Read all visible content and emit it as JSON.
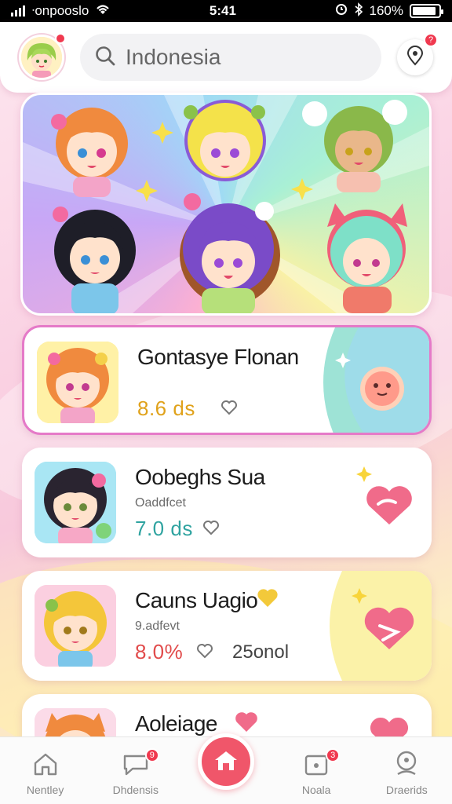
{
  "status_bar": {
    "carrier": "ᐧonpooslo",
    "time": "5:41",
    "battery": "160%",
    "battery_level": 0.9
  },
  "header": {
    "avatar_badge": "",
    "search": {
      "placeholder": "Indonesia",
      "icon": "search-icon"
    },
    "location_badge": "?"
  },
  "cards": [
    {
      "title": "Gontasye Flonan",
      "subtitle": "",
      "stat": "8.6 ds",
      "stat_color": "#e0a21b",
      "extra": "",
      "accent": "#7fd3ec"
    },
    {
      "title": "Oobeghs Sua",
      "subtitle": "Oaddfcet",
      "stat": "7.0 ds",
      "stat_color": "#2fa3a0",
      "extra": "",
      "accent": "#f06b8a"
    },
    {
      "title": "Cauns Uagio",
      "subtitle": "9.adfevt",
      "stat": "8.0%",
      "stat_color": "#e14b4b",
      "extra": "25onol",
      "accent": "#f3c93a"
    },
    {
      "title": "Aoleiage",
      "subtitle": "",
      "stat": "",
      "stat_color": "#444",
      "extra": "",
      "accent": "#f06b8a"
    }
  ],
  "bottom_nav": [
    {
      "label": "Nentley",
      "icon": "home-outline-icon",
      "badge": ""
    },
    {
      "label": "Dhdensis",
      "icon": "chat-icon",
      "badge": "9"
    },
    {
      "label": "",
      "icon": "home-icon",
      "badge": ""
    },
    {
      "label": "Noala",
      "icon": "calendar-icon",
      "badge": "3"
    },
    {
      "label": "Draerids",
      "icon": "profile-icon",
      "badge": ""
    }
  ]
}
